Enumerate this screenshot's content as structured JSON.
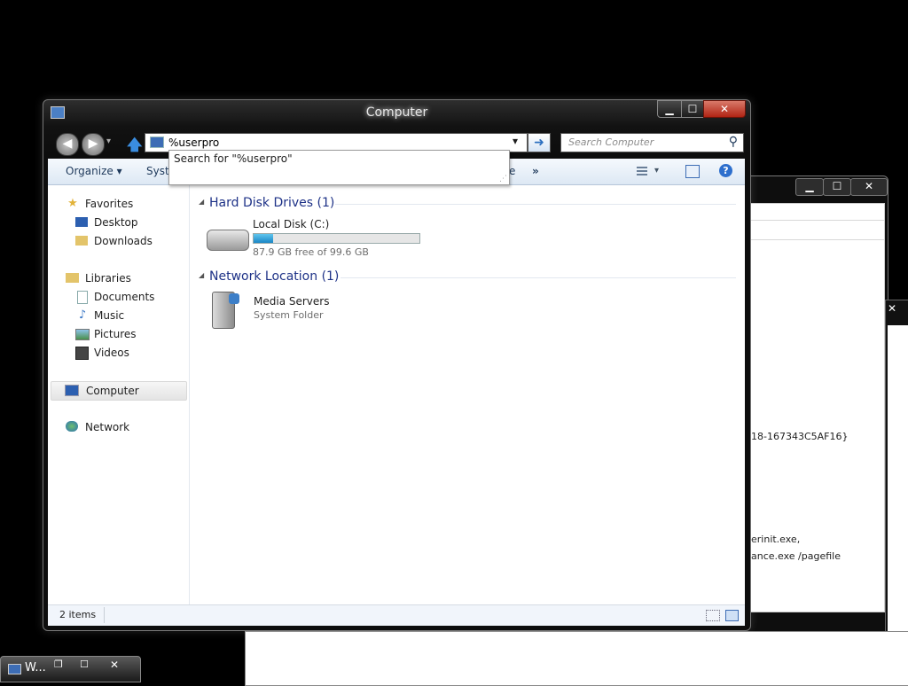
{
  "window": {
    "title": "Computer",
    "minimize": "▁",
    "maximize": "☐",
    "close": "✕"
  },
  "address": {
    "value": "%userpro",
    "dropdown": "▾",
    "go": "➜"
  },
  "search": {
    "placeholder": "Search Computer",
    "icon": "⚲"
  },
  "suggestion": {
    "text": "Search for \"%userpro\""
  },
  "toolbar": {
    "organize": "Organize ▾",
    "system_partial": "Syste",
    "e_partial": "e",
    "more": "»",
    "help": "?"
  },
  "nav": {
    "favorites": "Favorites",
    "desktop": "Desktop",
    "downloads": "Downloads",
    "libraries": "Libraries",
    "documents": "Documents",
    "music": "Music",
    "pictures": "Pictures",
    "videos": "Videos",
    "computer": "Computer",
    "network": "Network"
  },
  "groups": {
    "hdd": "Hard Disk Drives (1)",
    "network": "Network Location (1)"
  },
  "drive": {
    "name": "Local Disk (C:)",
    "free": "87.9 GB free of 99.6 GB",
    "used_fraction": 0.118
  },
  "media": {
    "name": "Media Servers",
    "type": "System Folder"
  },
  "status": {
    "count": "2 items"
  },
  "background_text": {
    "line1": "18-167343C5AF16}",
    "line2": "erinit.exe,",
    "line3": "ance.exe /pagefile"
  },
  "taskbar": {
    "label": "W..."
  },
  "colors": {
    "accent": "#1e3287",
    "drive_bar": "#26a0da"
  }
}
